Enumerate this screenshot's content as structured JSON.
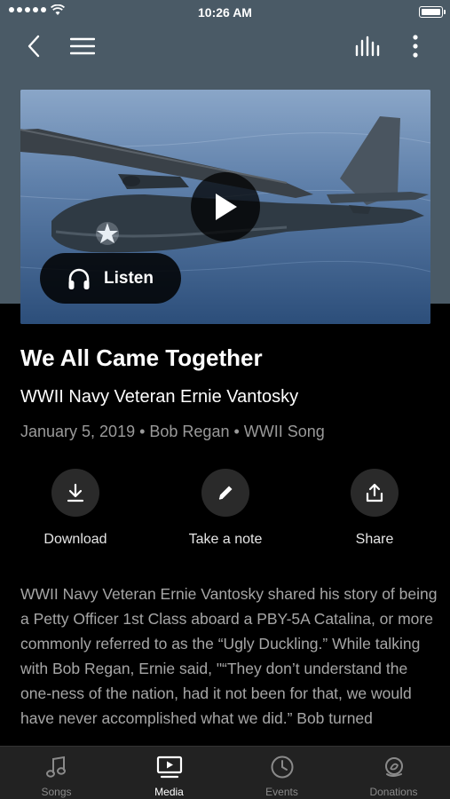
{
  "status_bar": {
    "time": "10:26 AM"
  },
  "media": {
    "title": "We All Came Together",
    "subtitle": "WWII Navy Veteran Ernie Vantosky",
    "meta": "January 5, 2019 • Bob Regan • WWII Song",
    "listen_label": "Listen",
    "actions": [
      {
        "label": "Download",
        "icon": "download-icon"
      },
      {
        "label": "Take a note",
        "icon": "pencil-icon"
      },
      {
        "label": "Share",
        "icon": "share-icon"
      }
    ],
    "description": "WWII Navy Veteran Ernie Vantosky shared his story of being a Petty Officer 1st Class aboard a PBY-5A Catalina, or more commonly referred to as the “Ugly Duckling.” While talking with Bob Regan, Ernie said, \"“They don’t understand the one-ness of the nation, had it not been for that, we would have never accomplished what we did.” Bob turned"
  },
  "tabs": [
    {
      "label": "Songs",
      "icon": "music-note-icon",
      "active": false
    },
    {
      "label": "Media",
      "icon": "media-player-icon",
      "active": true
    },
    {
      "label": "Events",
      "icon": "clock-icon",
      "active": false
    },
    {
      "label": "Donations",
      "icon": "donation-icon",
      "active": false
    }
  ],
  "colors": {
    "header_bg": "#4a5a66",
    "background": "#000000",
    "tabbar_bg": "#222222"
  }
}
